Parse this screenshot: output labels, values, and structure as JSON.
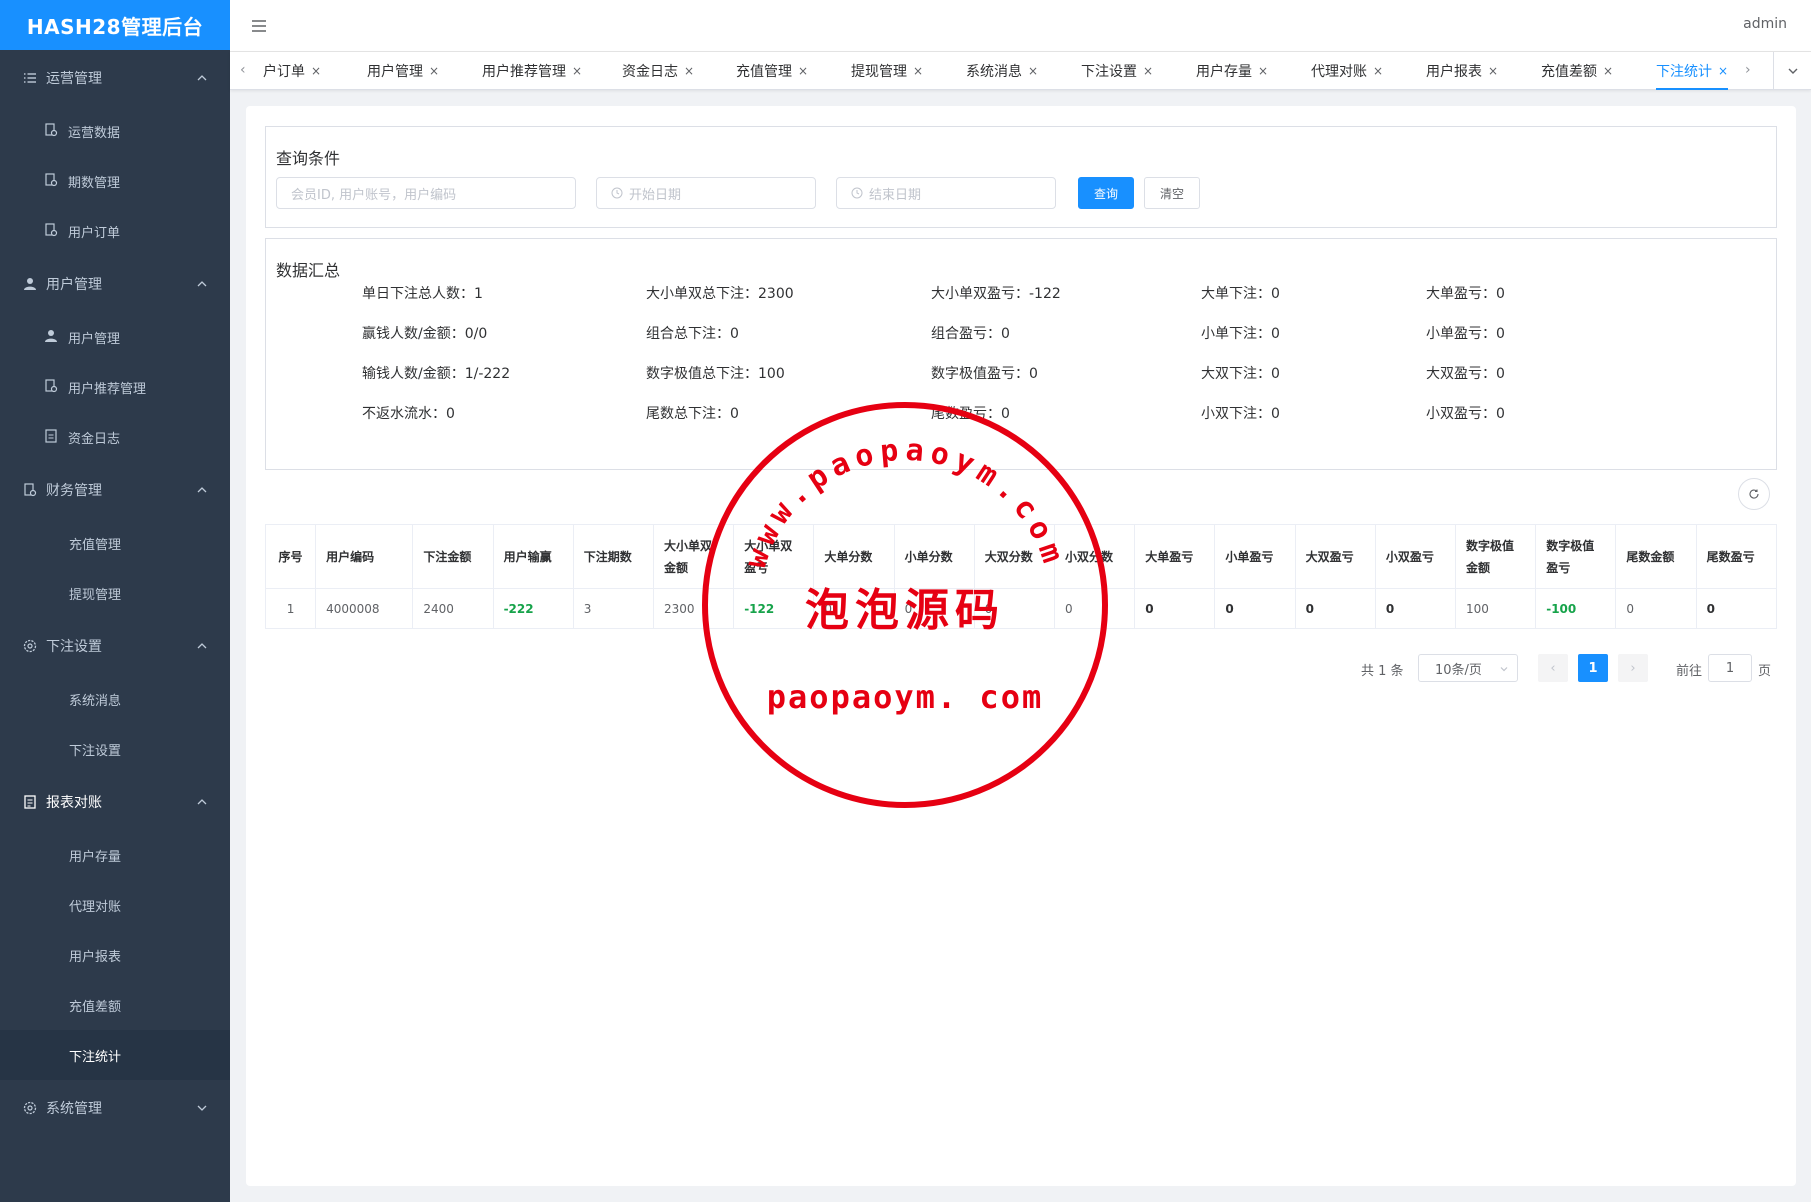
{
  "app": {
    "title": "HASH28管理后台",
    "user": "admin"
  },
  "sidebar": {
    "groups": [
      {
        "label": "运营管理",
        "icon": "list-icon",
        "items": [
          "运营数据",
          "期数管理",
          "用户订单"
        ]
      },
      {
        "label": "用户管理",
        "icon": "user-icon",
        "items": [
          "用户管理",
          "用户推荐管理",
          "资金日志"
        ]
      },
      {
        "label": "财务管理",
        "icon": "document-icon",
        "items": [
          "充值管理",
          "提现管理"
        ]
      },
      {
        "label": "下注设置",
        "icon": "gear-icon",
        "items": [
          "系统消息",
          "下注设置"
        ]
      },
      {
        "label": "报表对账",
        "icon": "report-icon",
        "items": [
          "用户存量",
          "代理对账",
          "用户报表",
          "充值差额",
          "下注统计"
        ]
      },
      {
        "label": "系统管理",
        "icon": "gear-icon",
        "items": []
      }
    ],
    "active_item": "下注统计"
  },
  "tabs": {
    "items": [
      "户订单",
      "用户管理",
      "用户推荐管理",
      "资金日志",
      "充值管理",
      "提现管理",
      "系统消息",
      "下注设置",
      "用户存量",
      "代理对账",
      "用户报表",
      "充值差额",
      "下注统计"
    ],
    "active": "下注统计",
    "close_glyph": "×"
  },
  "query": {
    "title": "查询条件",
    "member_placeholder": "会员ID, 用户账号，用户编码",
    "start_placeholder": "开始日期",
    "end_placeholder": "结束日期",
    "search_label": "查询",
    "clear_label": "清空"
  },
  "summary": {
    "title": "数据汇总",
    "rows": [
      [
        "单日下注总人数：1",
        "大小单双总下注：2300",
        "大小单双盈亏：-122",
        "大单下注：0",
        "大单盈亏：0"
      ],
      [
        "赢钱人数/金额：0/0",
        "组合总下注：0",
        "组合盈亏：0",
        "小单下注：0",
        "小单盈亏：0"
      ],
      [
        "输钱人数/金额：1/-222",
        "数字极值总下注：100",
        "数字极值盈亏：0",
        "大双下注：0",
        "大双盈亏：0"
      ],
      [
        "不返水流水：0",
        "尾数总下注：0",
        "尾数盈亏：0",
        "小双下注：0",
        "小双盈亏：0"
      ]
    ]
  },
  "table": {
    "headers": [
      "序号",
      "用户编码",
      "下注金额",
      "用户输赢",
      "下注期数",
      "大小单双\n金额",
      "大小单双\n盈亏",
      "大单分数",
      "小单分数",
      "大双分数",
      "小双分数",
      "大单盈亏",
      "小单盈亏",
      "大双盈亏",
      "小双盈亏",
      "数字极值\n金额",
      "数字极值\n盈亏",
      "尾数金额",
      "尾数盈亏"
    ],
    "rows": [
      [
        "1",
        "4000008",
        "2400",
        "-222",
        "3",
        "2300",
        "-122",
        "0",
        "0",
        "0",
        "0",
        "0",
        "0",
        "0",
        "0",
        "100",
        "-100",
        "0",
        "0"
      ]
    ]
  },
  "pagination": {
    "total_text": "共 1 条",
    "page_size": "10条/页",
    "current_page": "1",
    "goto_label": "前往",
    "goto_value": "1",
    "page_suffix": "页",
    "prev": "‹",
    "next": "›"
  },
  "watermark": {
    "arc_text": "www.paopaoym.com",
    "chinese": "泡泡源码",
    "bottom": "paopaoym. com",
    "color": "#e60012"
  },
  "colors": {
    "accent": "#1890ff",
    "sidebar": "#2d3a4b",
    "positive": "#16a34a"
  }
}
